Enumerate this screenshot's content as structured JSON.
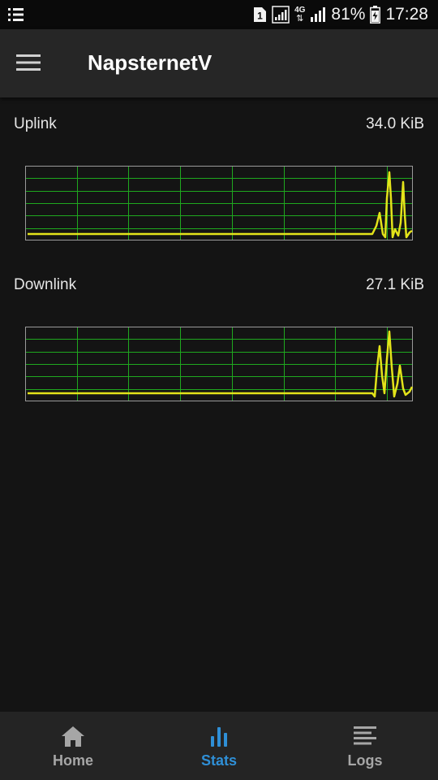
{
  "status_bar": {
    "sim_badge": "1",
    "network_type": "4G",
    "battery": "81%",
    "time": "17:28"
  },
  "app_bar": {
    "title": "NapsternetV"
  },
  "stats": {
    "uplink": {
      "label": "Uplink",
      "value": "34.0 KiB"
    },
    "downlink": {
      "label": "Downlink",
      "value": "27.1 KiB"
    }
  },
  "nav": {
    "items": [
      {
        "label": "Home",
        "icon": "home-icon",
        "active": false
      },
      {
        "label": "Stats",
        "icon": "bar-chart-icon",
        "active": true
      },
      {
        "label": "Logs",
        "icon": "list-icon",
        "active": false
      }
    ]
  },
  "colors": {
    "grid": "#1fa81f",
    "trace": "#e3e31a",
    "active": "#2f8fd6",
    "inactive": "#a6a6a6"
  }
}
